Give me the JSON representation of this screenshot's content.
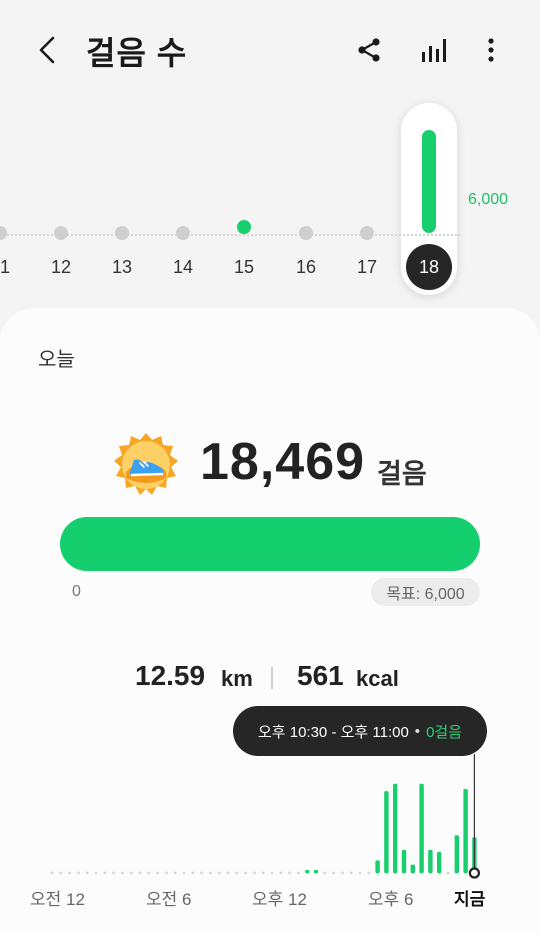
{
  "header": {
    "title": "걸음 수",
    "back_icon": "back-arrow-icon",
    "share_icon": "share-icon",
    "chart_icon": "bar-chart-icon",
    "more_icon": "more-vertical-icon"
  },
  "week": {
    "goal_label": "6,000",
    "days": [
      {
        "label": "1",
        "steps": 0
      },
      {
        "label": "12",
        "steps": 0
      },
      {
        "label": "13",
        "steps": 0
      },
      {
        "label": "14",
        "steps": 0
      },
      {
        "label": "15",
        "steps": 2100
      },
      {
        "label": "16",
        "steps": 0
      },
      {
        "label": "17",
        "steps": 0
      },
      {
        "label": "18",
        "steps": 18469,
        "selected": true
      }
    ]
  },
  "today": {
    "label": "오늘",
    "medal_icon": "sneaker-medal-icon",
    "steps": "18,469",
    "steps_unit": "걸음",
    "progress_fraction": 1.0,
    "progress_start": "0",
    "goal_text": "목표: 6,000"
  },
  "stats": {
    "distance_value": "12.59",
    "distance_unit": "km",
    "kcal_value": "561",
    "kcal_unit": "kcal"
  },
  "tooltip": {
    "range": "오후 10:30 - 오후 11:00",
    "bullet": "•",
    "steps": "0걸음"
  },
  "colors": {
    "accent": "#18cf6e",
    "dark": "#262626",
    "dot": "#cfcfcf"
  },
  "chart_data": {
    "type": "bar",
    "x_labels": [
      "오전 12",
      "오전 6",
      "오후 12",
      "오후 6",
      "지금"
    ],
    "bins": [
      {
        "slot": 29,
        "value": 2
      },
      {
        "slot": 30,
        "value": 2
      },
      {
        "slot": 37,
        "value": 12
      },
      {
        "slot": 38,
        "value": 78
      },
      {
        "slot": 39,
        "value": 85
      },
      {
        "slot": 40,
        "value": 22
      },
      {
        "slot": 41,
        "value": 8
      },
      {
        "slot": 42,
        "value": 85
      },
      {
        "slot": 43,
        "value": 22
      },
      {
        "slot": 44,
        "value": 20
      },
      {
        "slot": 46,
        "value": 36
      },
      {
        "slot": 47,
        "value": 80
      },
      {
        "slot": 48,
        "value": 34
      }
    ],
    "total_slots": 48,
    "ymax": 100
  }
}
